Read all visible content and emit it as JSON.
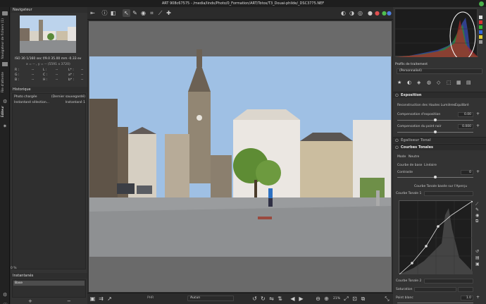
{
  "window": {
    "title": "ART 908c67575 - /media/linds/Photo/0_Formation/ART/Totos/T3_Douai-philde/_DSC3775.NEF"
  },
  "side_tabs": {
    "file_browser": "Navigateur de fichiers (1)",
    "queue": "File d'attente",
    "editor": "Éditeur"
  },
  "navigator": {
    "title": "Navigateur",
    "exif": "ISO 30   1/160 sec   f/9.0   35.00 mm   -0.33 ev",
    "coords": "x = -- , y = --          (5591 x 3720)",
    "values": [
      {
        "a": "R :",
        "av": "--",
        "b": "L :",
        "bv": "--",
        "c": "L* :",
        "cv": "--"
      },
      {
        "a": "G :",
        "av": "--",
        "b": "C :",
        "bv": "--",
        "c": "a* :",
        "cv": "--"
      },
      {
        "a": "B :",
        "av": "--",
        "b": "H :",
        "bv": "--",
        "c": "b* :",
        "cv": "--"
      }
    ]
  },
  "history": {
    "title": "Historique",
    "items": [
      {
        "label": "Photo chargée",
        "value": "(Dernier sauvegardé)"
      },
      {
        "label": "Instantané sélection...",
        "value": "Instantané 1"
      }
    ]
  },
  "snapshots": {
    "title": "Instantanés",
    "items": [
      "Base"
    ],
    "add": "+",
    "remove": "−"
  },
  "left_footer": {
    "percent": "0 %"
  },
  "bottombar": {
    "label": "PHR",
    "zoom_select": "Aucun",
    "zoom_value": "21%"
  },
  "right": {
    "profile_title": "Profils de traitement",
    "profile_value": "(Personnalisé)",
    "exposure": {
      "title": "Exposition",
      "hl_recon_label": "Reconstruction des Hautes Lumières",
      "hl_recon_value": "Equilibré",
      "comp_label": "Compensation d'exposition",
      "comp_value": "0.00",
      "black_label": "Compensation du point noir",
      "black_value": "0.000"
    },
    "tone_eq": {
      "title": "Égaliseur Tonal"
    },
    "tone_curves": {
      "title": "Courbes Tonales",
      "mode_label": "Mode",
      "mode_value": "Neutre",
      "base_label": "Courbe de base",
      "base_value": "Linéaire",
      "contrast_label": "Contraste",
      "contrast_value": "0",
      "based_label": "Courbe Tonale basée sur l'Aperçu",
      "curve1_label": "Courbe Tonale 1",
      "curve2_label": "Courbe Tonale 2",
      "saturation_label": "Saturation",
      "whitepoint_label": "Point blanc",
      "whitepoint_value": "1.0"
    }
  },
  "colors": {
    "accent": "#3c8fcf",
    "panel": "#333333",
    "histogram_annotation": "#ffffff"
  }
}
